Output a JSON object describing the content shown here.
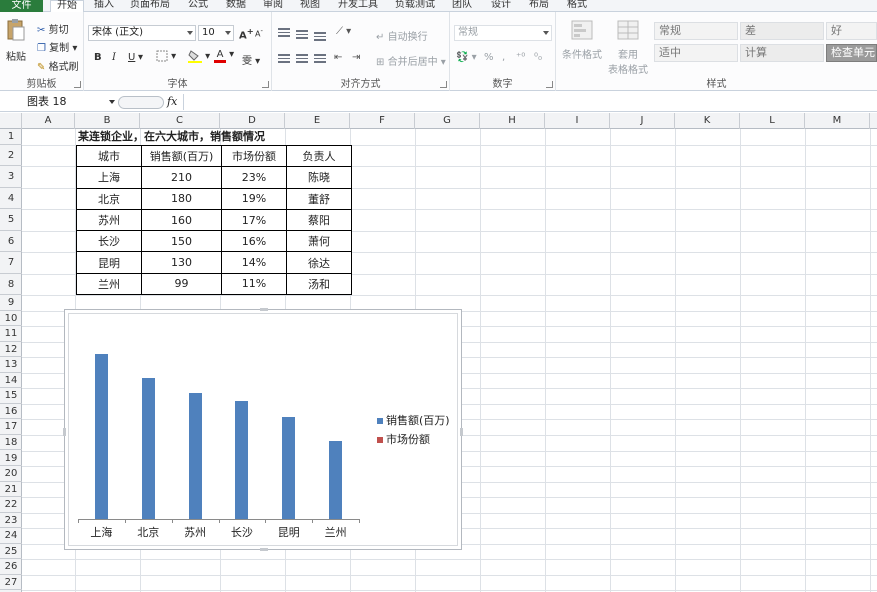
{
  "ribbon": {
    "tabs": [
      "文件",
      "开始",
      "插入",
      "页面布局",
      "公式",
      "数据",
      "审阅",
      "视图",
      "开发工具",
      "负载测试",
      "团队",
      "设计",
      "布局",
      "格式"
    ],
    "clipboard": {
      "paste": "粘贴",
      "cut": "剪切",
      "copy": "复制",
      "format_painter": "格式刷",
      "label": "剪贴板"
    },
    "font": {
      "name": "宋体 (正文)",
      "size": "10",
      "bold": "B",
      "italic": "I",
      "underline": "U",
      "grow": "A",
      "shrink": "A",
      "font_color": "A",
      "phonetic": "雯",
      "label": "字体"
    },
    "alignment": {
      "wrap": "自动换行",
      "merge": "合并后居中",
      "label": "对齐方式"
    },
    "number": {
      "format": "常规",
      "percent": "%",
      "comma": ",",
      "label": "数字"
    },
    "styles_group": {
      "conditional": "条件格式",
      "table_format_line1": "套用",
      "table_format_line2": "表格格式",
      "label": "样式"
    },
    "styles": [
      {
        "name": "常规"
      },
      {
        "name": "差"
      },
      {
        "name": "好"
      },
      {
        "name": "适中"
      },
      {
        "name": "计算"
      },
      {
        "name": "检查单元"
      }
    ]
  },
  "formula_bar": {
    "name_box": "图表 18",
    "fx": "fx"
  },
  "columns": [
    "A",
    "B",
    "C",
    "D",
    "E",
    "F",
    "G",
    "H",
    "I",
    "J",
    "K",
    "L",
    "M"
  ],
  "rows": [
    "1",
    "2",
    "3",
    "4",
    "5",
    "6",
    "7",
    "8",
    "9",
    "10",
    "11",
    "12",
    "13",
    "14",
    "15",
    "16",
    "17",
    "18",
    "19",
    "20",
    "21",
    "22",
    "23",
    "24",
    "25",
    "26",
    "27"
  ],
  "sheet": {
    "title": "某连锁企业，在六大城市，销售额情况",
    "headers": [
      "城市",
      "销售额(百万)",
      "市场份额",
      "负责人"
    ],
    "rows": [
      [
        "上海",
        "210",
        "23%",
        "陈晓"
      ],
      [
        "北京",
        "180",
        "19%",
        "董舒"
      ],
      [
        "苏州",
        "160",
        "17%",
        "蔡阳"
      ],
      [
        "长沙",
        "150",
        "16%",
        "萧何"
      ],
      [
        "昆明",
        "130",
        "14%",
        "徐达"
      ],
      [
        "兰州",
        "99",
        "11%",
        "汤和"
      ]
    ]
  },
  "chart_data": {
    "type": "bar",
    "categories": [
      "上海",
      "北京",
      "苏州",
      "长沙",
      "昆明",
      "兰州"
    ],
    "series": [
      {
        "name": "销售额(百万)",
        "values": [
          210,
          180,
          160,
          150,
          130,
          99
        ],
        "color": "#4f81bd"
      },
      {
        "name": "市场份额",
        "values": [
          0.23,
          0.19,
          0.17,
          0.16,
          0.14,
          0.11
        ],
        "color": "#c0504d"
      }
    ],
    "ylim": [
      0,
      210
    ],
    "legend": "right",
    "grid": false
  }
}
